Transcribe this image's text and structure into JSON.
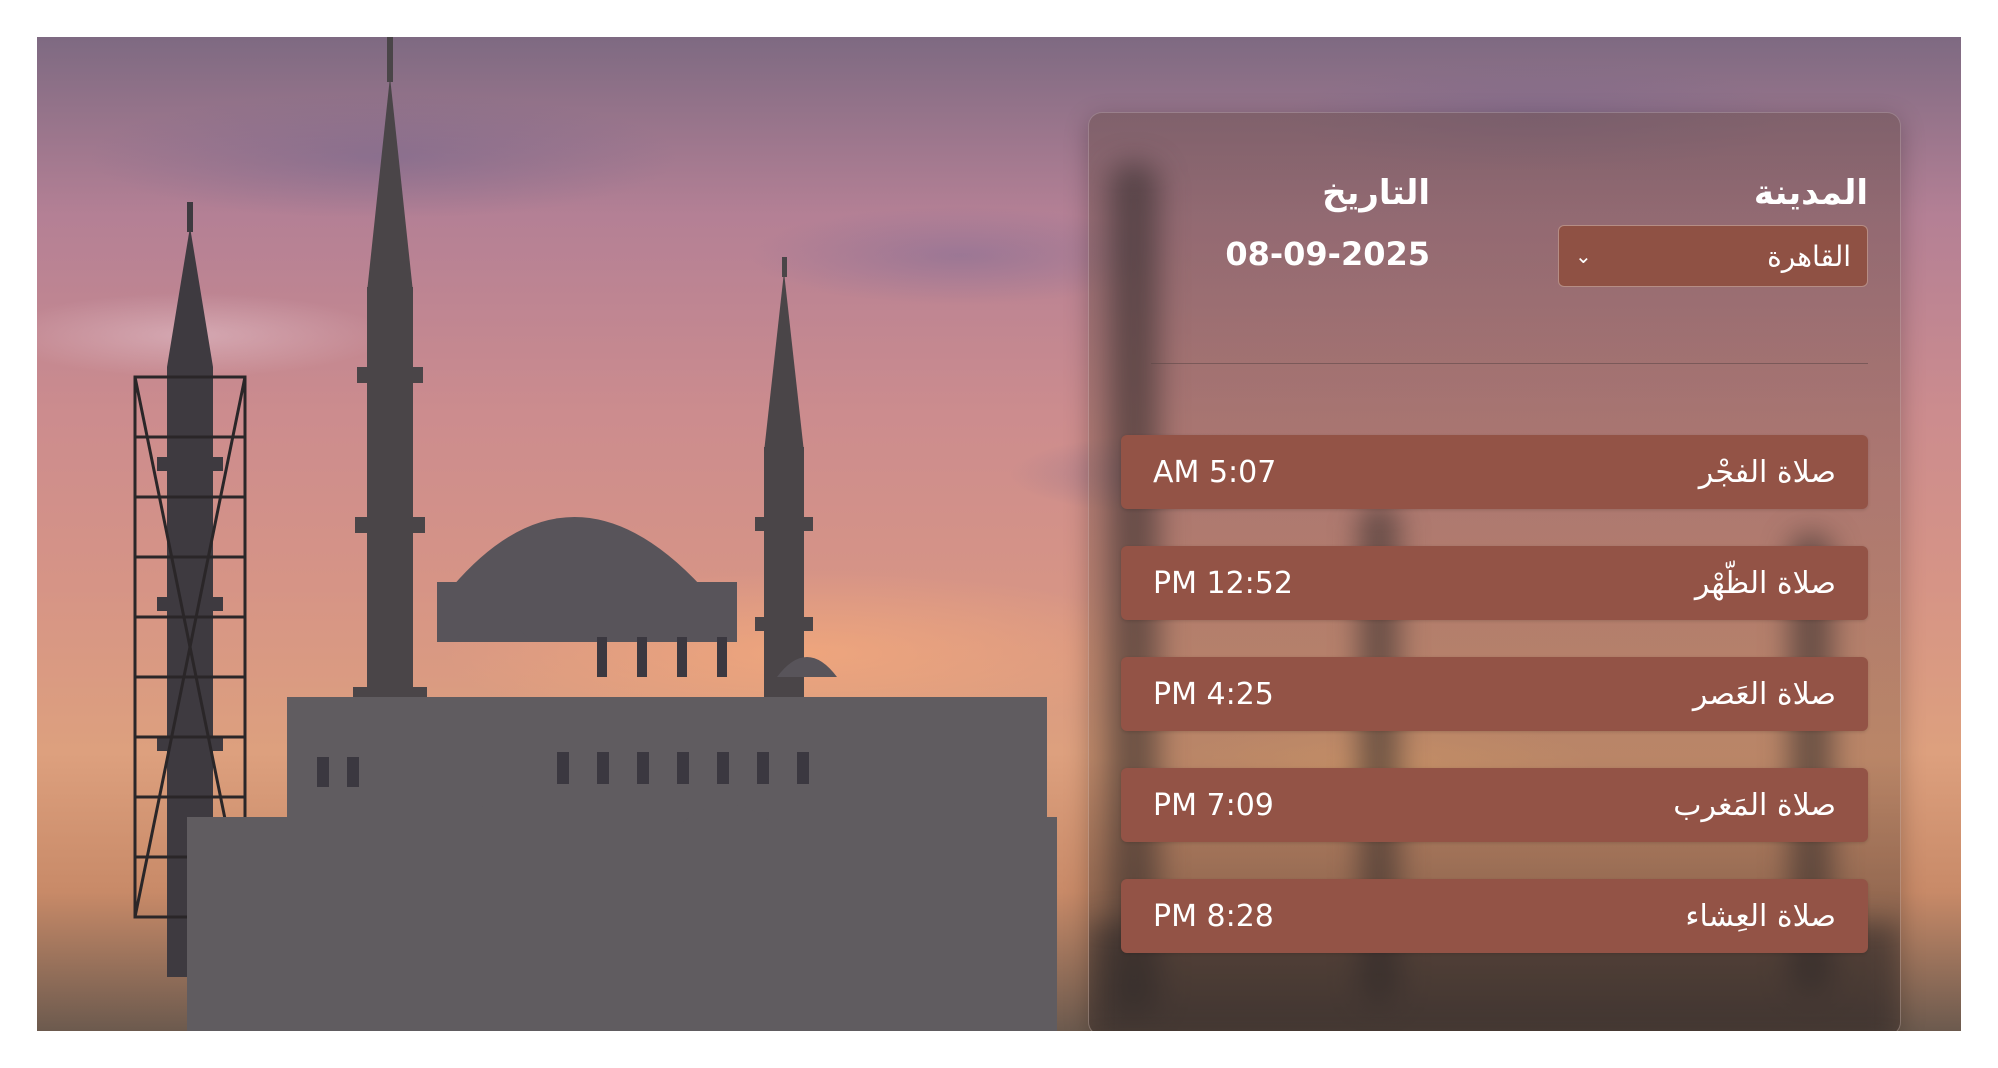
{
  "labels": {
    "city": "المدينة",
    "date": "التاريخ"
  },
  "city_select": {
    "selected": "القاهرة"
  },
  "date_value": "08-09-2025",
  "prayers": [
    {
      "name": "صلاة الفجْر",
      "time": "AM 5:07"
    },
    {
      "name": "صلاة الظّهْر",
      "time": "PM 12:52"
    },
    {
      "name": "صلاة العَصر",
      "time": "PM 4:25"
    },
    {
      "name": "صلاة المَغرب",
      "time": "PM 7:09"
    },
    {
      "name": "صلاة العِشاء",
      "time": "PM 8:28"
    }
  ],
  "icons": {
    "select_chevron": "chevron-down-icon"
  },
  "colors": {
    "row_bg": "#935346",
    "select_bg": "#8f5144",
    "text": "#ffffff"
  }
}
